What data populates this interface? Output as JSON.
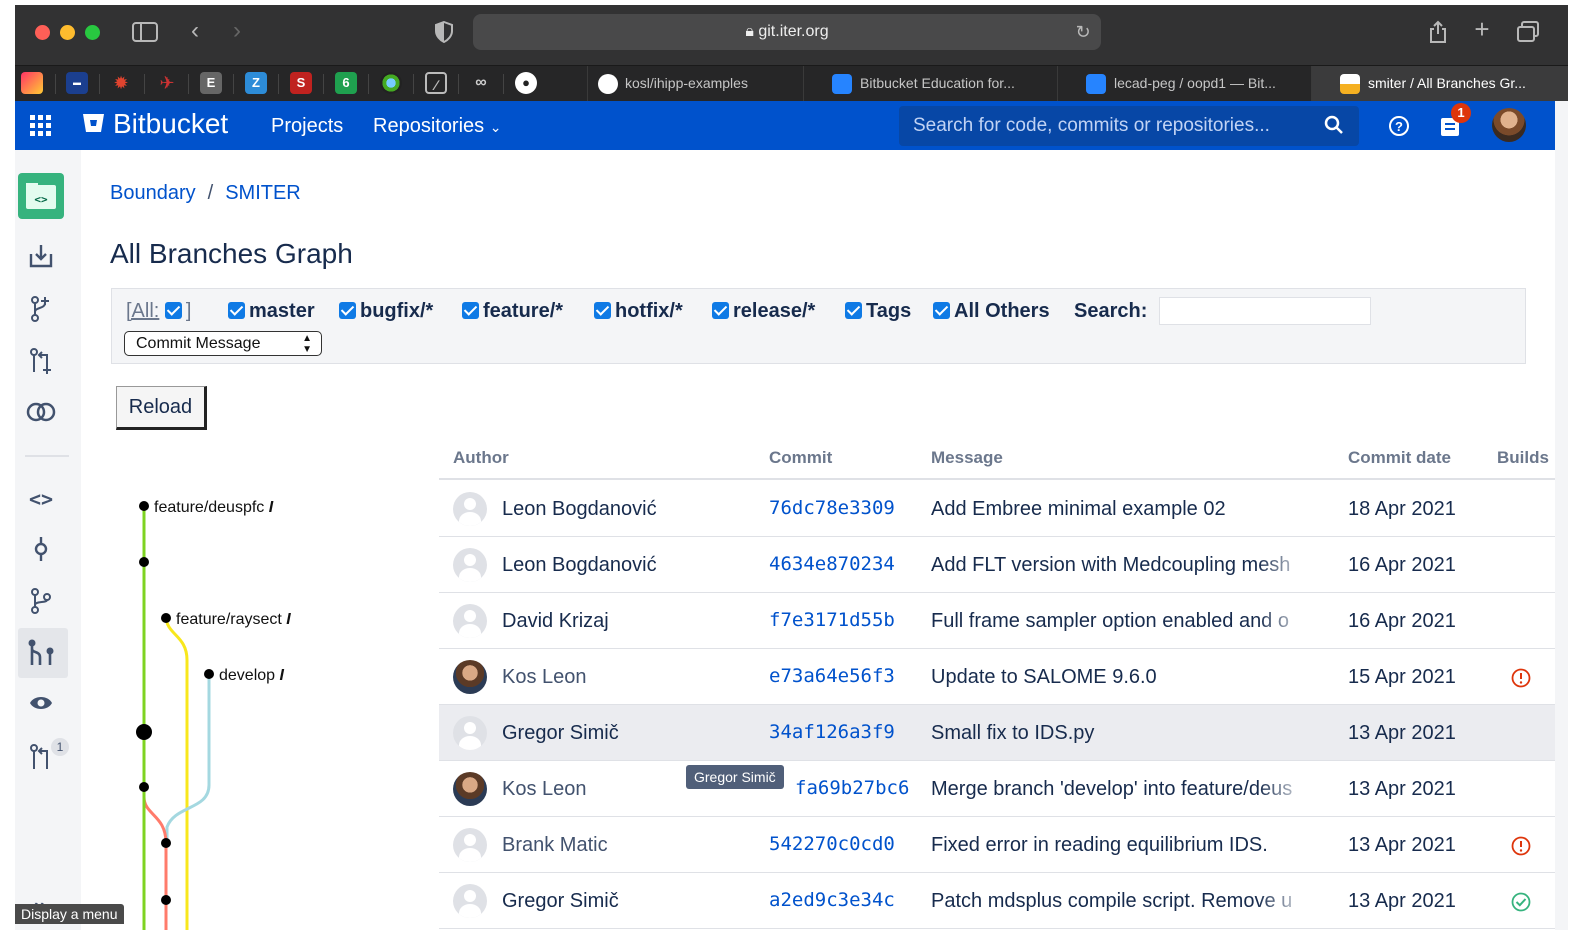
{
  "browser": {
    "url": "git.iter.org",
    "tabs": [
      {
        "label": "kosl/ihipp-examples",
        "active": false
      },
      {
        "label": "Bitbucket Education for...",
        "active": false
      },
      {
        "label": "lecad-peg / oopd1 — Bit...",
        "active": false
      },
      {
        "label": "smiter / All Branches Gr...",
        "active": true
      }
    ],
    "pinned_favicons": [
      "E",
      "Z",
      "S",
      "6"
    ]
  },
  "header": {
    "logo": "Bitbucket",
    "nav": {
      "projects": "Projects",
      "repositories": "Repositories"
    },
    "search_placeholder": "Search for code, commits or repositories...",
    "notification_count": "1"
  },
  "sidebar": {
    "items": [
      "repo-icon",
      "clone-icon",
      "create-branch-icon",
      "create-pr-icon",
      "compare-icon",
      "source-icon",
      "commits-icon",
      "branches-icon",
      "all-branches-graph-icon",
      "watch-icon",
      "pull-requests-icon"
    ],
    "pull_requests_badge": "1",
    "expand_tooltip": "Display a menu"
  },
  "breadcrumb": {
    "project": "Boundary",
    "separator": "/",
    "repo": "SMITER"
  },
  "page_title": "All Branches Graph",
  "filters": {
    "all_open": "[All:",
    "all_close": "]",
    "items": [
      "master",
      "bugfix/*",
      "feature/*",
      "hotfix/*",
      "release/*",
      "Tags",
      "All Others"
    ],
    "search_label": "Search:",
    "search_value": "",
    "display_select": "Commit Message"
  },
  "reload_label": "Reload",
  "graph_branches": [
    {
      "name": "feature/deuspfc",
      "color": "#7ed321"
    },
    {
      "name": "feature/raysect",
      "color": "#f8e71c"
    },
    {
      "name": "develop",
      "color": "#a4d8e0"
    }
  ],
  "table": {
    "headers": {
      "author": "Author",
      "commit": "Commit",
      "message": "Message",
      "date": "Commit date",
      "builds": "Builds"
    },
    "rows": [
      {
        "author": "Leon Bogdanović",
        "commit": "76dc78e3309",
        "message": "Add Embree minimal example 02",
        "date": "18 Apr 2021",
        "build": "",
        "photo": false
      },
      {
        "author": "Leon Bogdanović",
        "commit": "4634e870234",
        "message": "Add FLT version with Medcoupling mesh",
        "date": "16 Apr 2021",
        "build": "",
        "photo": false
      },
      {
        "author": "David Krizaj",
        "commit": "f7e3171d55b",
        "message": "Full frame sampler option enabled and o",
        "date": "16 Apr 2021",
        "build": "",
        "photo": false
      },
      {
        "author": "Kos Leon",
        "commit": "e73a64e56f3",
        "message": "Update to SALOME 9.6.0",
        "date": "15 Apr 2021",
        "build": "failed",
        "photo": true
      },
      {
        "author": "Gregor Simič",
        "commit": "34af126a3f9",
        "message": "Small fix to IDS.py",
        "date": "13 Apr 2021",
        "build": "",
        "photo": false
      },
      {
        "author": "Kos Leon",
        "commit": "fa69b27bc6",
        "message": "Merge branch 'develop' into feature/deus",
        "date": "13 Apr 2021",
        "build": "",
        "photo": true
      },
      {
        "author": "Brank Matic",
        "commit": "542270c0cd0",
        "message": "Fixed error in reading equilibrium IDS.",
        "date": "13 Apr 2021",
        "build": "failed",
        "photo": false
      },
      {
        "author": "Gregor Simič",
        "commit": "a2ed9c3e34c",
        "message": "Patch mdsplus compile script. Remove u",
        "date": "13 Apr 2021",
        "build": "success",
        "photo": false
      }
    ],
    "hover_tooltip": "Gregor Simič"
  },
  "colors": {
    "brand": "#0052cc",
    "success": "#36b37e",
    "failed": "#de350b"
  }
}
